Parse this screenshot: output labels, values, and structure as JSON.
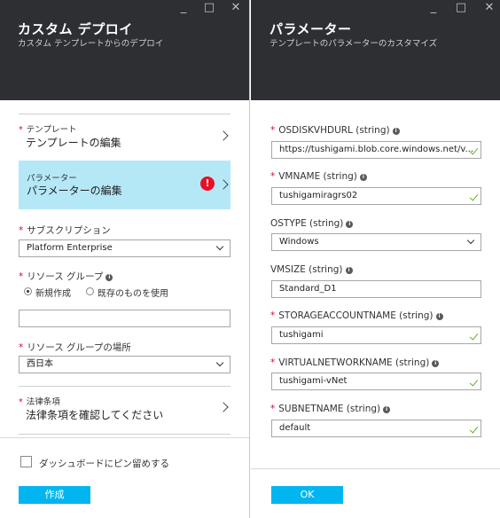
{
  "left_blade": {
    "title": "カスタム デプロイ",
    "subtitle": "カスタム テンプレートからのデプロイ",
    "controls": {
      "minimize": "_",
      "maximize": "□",
      "close": "✕"
    },
    "template_item": {
      "label": "テンプレート",
      "value": "テンプレートの編集"
    },
    "parameters_item": {
      "label": "パラメーター",
      "value": "パラメーターの編集",
      "error_icon": "!"
    },
    "subscription": {
      "label": "サブスクリプション",
      "value": "Platform Enterprise"
    },
    "resource_group": {
      "label": "リソース グループ",
      "info_icon": "i",
      "option_new": "新規作成",
      "option_existing": "既存のものを使用",
      "value": ""
    },
    "location": {
      "label": "リソース グループの場所",
      "value": "西日本"
    },
    "legal": {
      "label": "法律条項",
      "value": "法律条項を確認してください"
    },
    "pin_dashboard": "ダッシュボードにピン留めする",
    "create_button": "作成"
  },
  "right_blade": {
    "title": "パラメーター",
    "subtitle": "テンプレートのパラメーターのカスタマイズ",
    "controls": {
      "minimize": "_",
      "maximize": "□",
      "close": "✕"
    },
    "params": [
      {
        "label": "OSDISKVHDURL (string)",
        "value": "https://tushigami.blob.core.windows.net/v...",
        "required": true
      },
      {
        "label": "VMNAME (string)",
        "value": "tushigamiragrs02",
        "required": true
      },
      {
        "label": "OSTYPE (string)",
        "value": "Windows",
        "required": false
      },
      {
        "label": "VMSIZE (string)",
        "value": "Standard_D1",
        "required": false
      },
      {
        "label": "STORAGEACCOUNTNAME (string)",
        "value": "tushigami",
        "required": true
      },
      {
        "label": "VIRTUALNETWORKNAME (string)",
        "value": "tushigami-vNet",
        "required": true
      },
      {
        "label": "SUBNETNAME (string)",
        "value": "default",
        "required": true
      }
    ],
    "info_icon": "i",
    "ok_button": "OK"
  },
  "colors": {
    "header_bg": "#2d2f33",
    "selected_item_bg": "#b5e8f7",
    "button_bg": "#00b5f0",
    "required_star": "#c8102e",
    "valid_check": "#5fb320",
    "error_icon": "#e81123"
  }
}
